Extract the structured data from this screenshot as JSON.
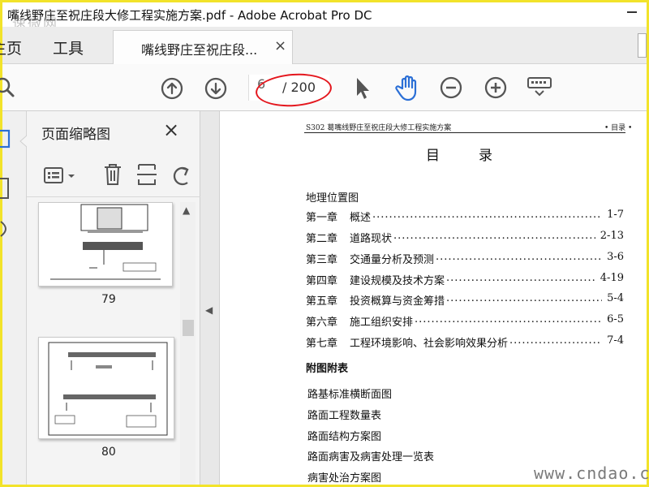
{
  "window": {
    "title": "嘴线野庄至祝庄段大修工程实施方案.pdf - Adobe Acrobat Pro DC",
    "watermark": "速微网"
  },
  "tabs": {
    "home": "主页",
    "tools": "工具",
    "doc": "嘴线野庄至祝庄段...",
    "doc_close": "×"
  },
  "toolbar": {
    "current_page": "6",
    "total_pages": "/ 200"
  },
  "panel": {
    "title": "页面缩略图",
    "close": "×",
    "thumbnails": [
      {
        "label": "79"
      },
      {
        "label": "80"
      }
    ]
  },
  "document": {
    "header_left": "S302 葛嘴线野庄至祝庄段大修工程实施方案",
    "header_right": "• 目录 •",
    "toc_title": "目录",
    "location_map": "地理位置图",
    "chapters": [
      {
        "num": "第一章",
        "name": "概述",
        "page": "1-7"
      },
      {
        "num": "第二章",
        "name": "道路现状",
        "page": "2-13"
      },
      {
        "num": "第三章",
        "name": "交通量分析及预测",
        "page": "3-6"
      },
      {
        "num": "第四章",
        "name": "建设规模及技术方案",
        "page": "4-19"
      },
      {
        "num": "第五章",
        "name": "投资概算与资金筹措",
        "page": "5-4"
      },
      {
        "num": "第六章",
        "name": "施工组织安排",
        "page": "6-5"
      },
      {
        "num": "第七章",
        "name": "工程环境影响、社会影响效果分析",
        "page": "7-4"
      }
    ],
    "appendix_title": "附图附表",
    "appendix_items": [
      "路基标准横断面图",
      "路面工程数量表",
      "路面结构方案图",
      "路面病害及病害处理一览表",
      "病害处治方案图"
    ]
  },
  "site_watermark": "www.cndao.com",
  "colors": {
    "accent_blue": "#2b6fd6",
    "annotation_red": "#e4161d",
    "frame_yellow": "#f2e32a"
  }
}
